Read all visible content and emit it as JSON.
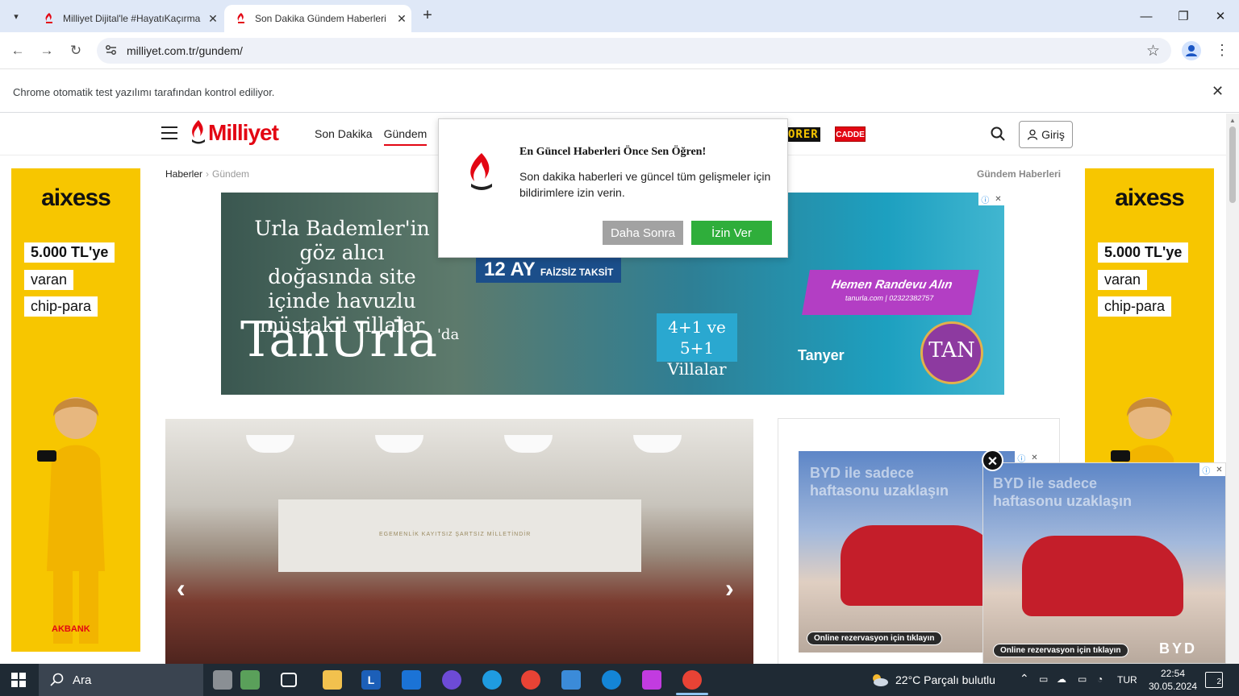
{
  "browser": {
    "tabs": [
      {
        "title": "Milliyet Dijital'le #HayatıKaçırma",
        "close": "✕"
      },
      {
        "title": "Son Dakika Gündem Haberleri",
        "close": "✕"
      }
    ],
    "new_tab": "+",
    "url": "milliyet.com.tr/gundem/",
    "infobar_text": "Chrome otomatik test yazılımı tarafından kontrol ediliyor.",
    "infobar_close": "✕",
    "window_controls": {
      "minimize": "—",
      "restore": "❐",
      "close": "✕"
    }
  },
  "site": {
    "logo_text": "Milliyet",
    "nav": [
      "Son Dakika",
      "Gündem"
    ],
    "partner_brands": {
      "prer": "ORER",
      "cadde": "CADDE"
    },
    "login_label": "Giriş",
    "breadcrumb": {
      "home": "Haberler",
      "current": "Gündem"
    },
    "section_title": "Gündem Haberleri"
  },
  "notification_prompt": {
    "title": "En Güncel Haberleri Önce Sen Öğren!",
    "body": "Son dakika haberleri ve güncel tüm gelişmeler için bildirimlere izin verin.",
    "later_button": "Daha Sonra",
    "allow_button": "İzin Ver"
  },
  "side_ad": {
    "brand": "aixess",
    "lines": [
      "5.000 TL'ye",
      "varan",
      "chip-para"
    ],
    "bank": "AKBANK"
  },
  "top_banner": {
    "copy": "Urla Bademler'in göz alıcı doğasında site içinde havuzlu müstakil villalar",
    "brand": "TanUrla",
    "brand_sup": "'da",
    "installment": "12 AY",
    "installment_sub": "FAİZSİZ TAKSİT",
    "villas": "4+1 ve 5+1 Villalar",
    "cta": "Hemen Randevu Alın",
    "cta_sub": "tanurla.com | 02322382757",
    "developer": "Tanyer",
    "badge": "TAN"
  },
  "slider": {
    "prev": "‹",
    "next": "›",
    "inscription": "EGEMENLİK KAYITSIZ ŞARTSIZ MİLLETİNDİR"
  },
  "car_ad": {
    "headline": "BYD ile sadece haftasonu uzaklaşın",
    "cta": "Online rezervasyon için tıklayın",
    "brand": "BYD"
  },
  "sticky_close": "✕",
  "taskbar": {
    "search_placeholder": "Ara",
    "weather": "22°C  Parçalı bulutlu",
    "language": "TUR",
    "time": "22:54",
    "date": "30.05.2024",
    "notifications": "2"
  },
  "colors": {
    "brand_red": "#e30613",
    "ad_yellow": "#f7c600",
    "allow_green": "#2fae3b",
    "later_gray": "#a2a2a2"
  }
}
